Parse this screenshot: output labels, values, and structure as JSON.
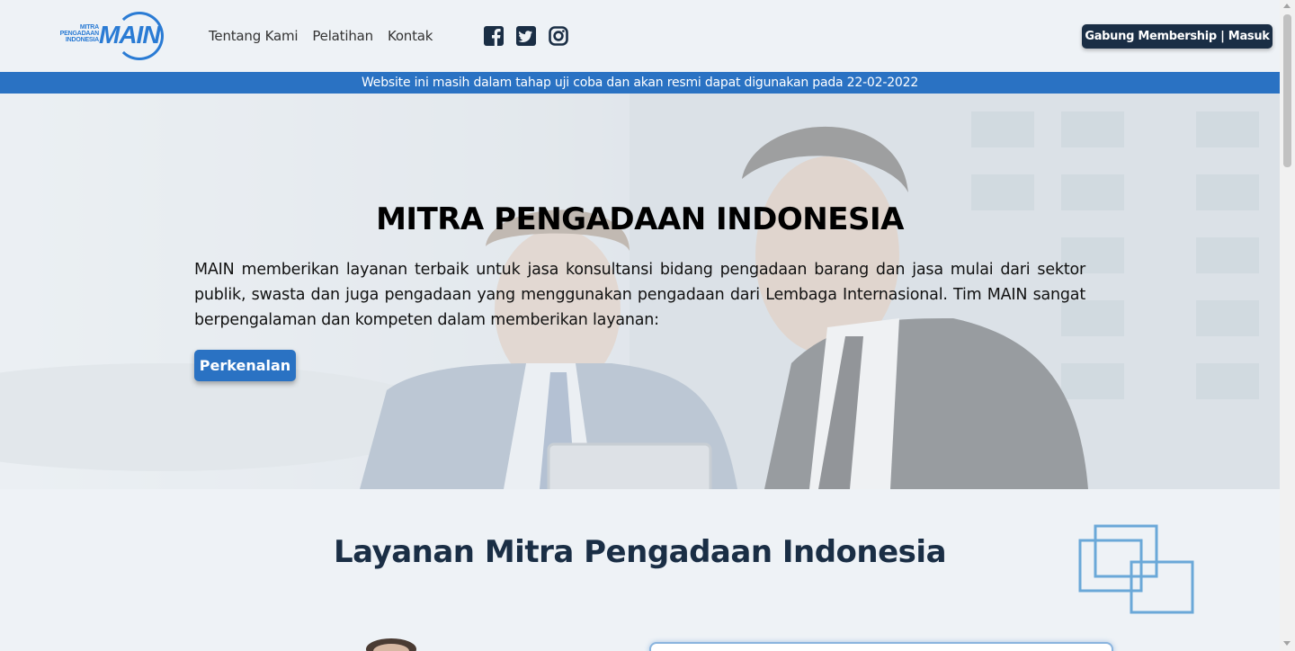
{
  "header": {
    "logo": {
      "small_lines": [
        "MITRA",
        "PENGADAAN",
        "INDONESIA"
      ],
      "big": "MAIN"
    },
    "nav": [
      {
        "label": "Tentang Kami"
      },
      {
        "label": "Pelatihan"
      },
      {
        "label": "Kontak"
      }
    ],
    "social": [
      "facebook-icon",
      "twitter-icon",
      "instagram-icon"
    ],
    "join_button": "Gabung Membership | Masuk"
  },
  "notice": "Website ini masih dalam tahap uji coba dan akan resmi dapat digunakan pada 22-02-2022",
  "hero": {
    "title": "MITRA PENGADAAN INDONESIA",
    "text": "MAIN memberikan layanan terbaik untuk jasa konsultansi bidang pengadaan barang dan jasa mulai dari sektor publik, swasta dan juga pengadaan yang menggunakan pengadaan dari Lembaga Internasional. Tim MAIN sangat berpengalaman dan kompeten dalam memberikan layanan:",
    "button": "Perkenalan"
  },
  "services": {
    "title": "Layanan Mitra Pengadaan Indonesia"
  },
  "colors": {
    "brand_blue": "#2a72c3",
    "navy": "#1a2e45",
    "background": "#eef2f6"
  }
}
